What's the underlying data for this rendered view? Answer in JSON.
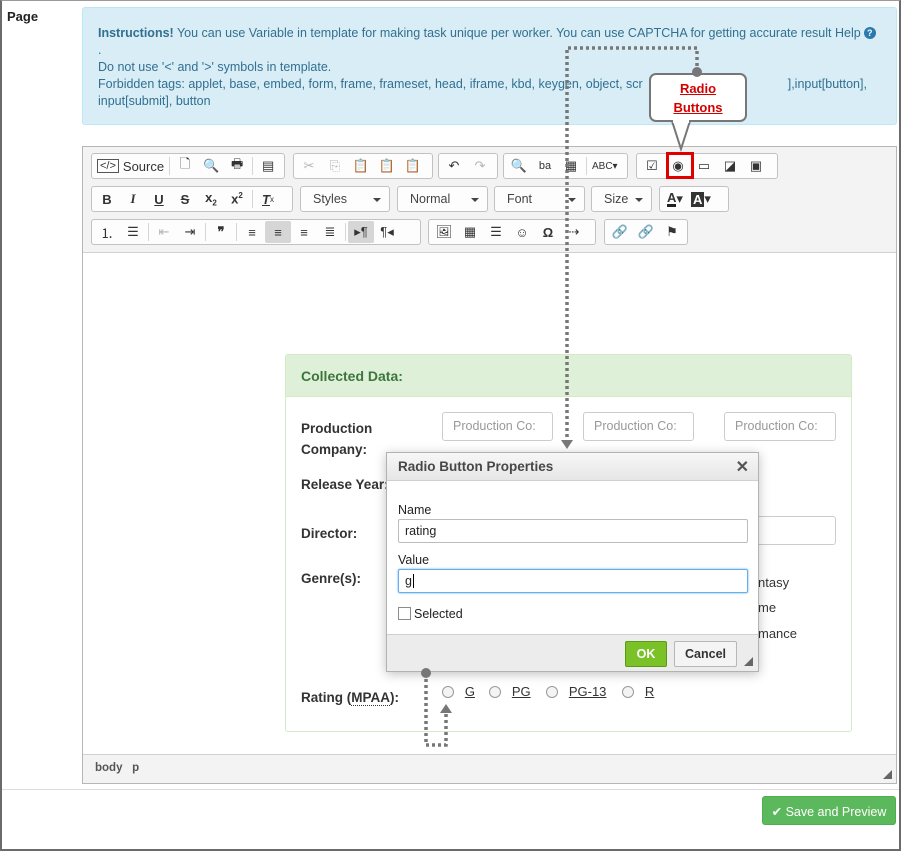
{
  "page_label": "Page",
  "instructions": {
    "bold": "Instructions!",
    "line1": " You can use Variable in template for making task unique per worker. You can use CAPTCHA for getting accurate result",
    "help": "Help",
    "dot": ".",
    "line2": "Do not use '<' and '>' symbols in template.",
    "line3a": "Forbidden tags: applet, base, embed, form, frame, frameset, head, iframe, kbd, keygen, object, scr",
    "line3b": "],input[button],",
    "line4": "input[submit], button"
  },
  "toolbar": {
    "source_label": "Source",
    "styles": "Styles",
    "format": "Normal",
    "font": "Font",
    "size": "Size"
  },
  "callout": {
    "line1": "Radio",
    "line2": "Buttons"
  },
  "panel": {
    "title": "Collected Data:",
    "production_label1": "Production",
    "production_label2": "Company:",
    "placeholder": "Production Co:",
    "release_label": "Release Year:",
    "director_label": "Director:",
    "genre_label": "Genre(s):",
    "genre_partial": [
      "ntasy",
      "me",
      "mance"
    ],
    "rating_label_pre": "Rating (",
    "rating_label_abbr": "MPAA",
    "rating_label_post": "):",
    "ratings": [
      "G",
      "PG",
      "PG-13",
      "R"
    ]
  },
  "dialog": {
    "title": "Radio Button Properties",
    "name_label": "Name",
    "name_value": "rating",
    "value_label": "Value",
    "value_value": "g",
    "selected_label": "Selected",
    "ok": "OK",
    "cancel": "Cancel"
  },
  "statusbar": {
    "path1": "body",
    "path2": "p"
  },
  "save_button": "Save and Preview"
}
